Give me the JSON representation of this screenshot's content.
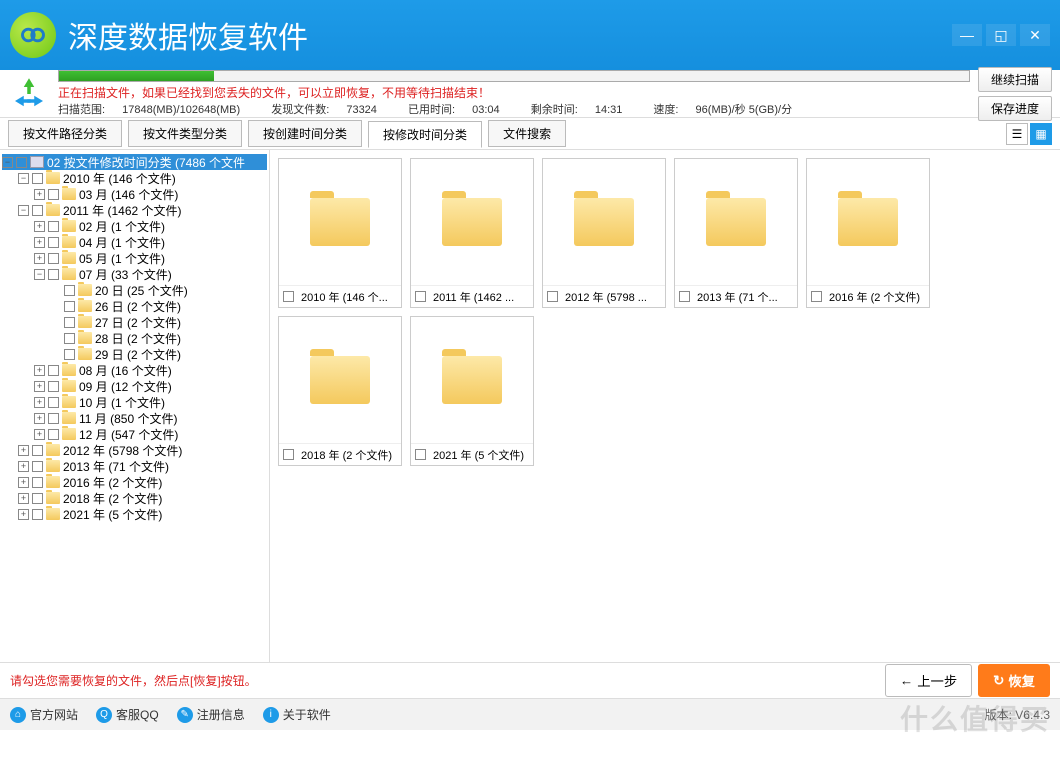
{
  "app": {
    "title": "深度数据恢复软件"
  },
  "scan": {
    "notice": "正在扫描文件，如果已经找到您丢失的文件，可以立即恢复，不用等待扫描结束！",
    "range_label": "扫描范围:",
    "range_value": "17848(MB)/102648(MB)",
    "found_label": "发现文件数:",
    "found_value": "73324",
    "elapsed_label": "已用时间:",
    "elapsed_value": "03:04",
    "remain_label": "剩余时间:",
    "remain_value": "14:31",
    "speed_label": "速度:",
    "speed_value": "96(MB)/秒  5(GB)/分",
    "btn_continue": "继续扫描",
    "btn_save": "保存进度"
  },
  "tabs": {
    "path": "按文件路径分类",
    "type": "按文件类型分类",
    "created": "按创建时间分类",
    "modified": "按修改时间分类",
    "search": "文件搜索"
  },
  "tree": {
    "root": "02 按文件修改时间分类    (7486 个文件",
    "y2010": "2010 年    (146 个文件)",
    "y2010_03": "03 月    (146 个文件)",
    "y2011": "2011 年    (1462 个文件)",
    "y2011_02": "02 月    (1 个文件)",
    "y2011_04": "04 月    (1 个文件)",
    "y2011_05": "05 月    (1 个文件)",
    "y2011_07": "07 月    (33 个文件)",
    "d20": "20 日    (25 个文件)",
    "d26": "26 日    (2 个文件)",
    "d27": "27 日    (2 个文件)",
    "d28": "28 日    (2 个文件)",
    "d29": "29 日    (2 个文件)",
    "y2011_08": "08 月    (16 个文件)",
    "y2011_09": "09 月    (12 个文件)",
    "y2011_10": "10 月    (1 个文件)",
    "y2011_11": "11 月    (850 个文件)",
    "y2011_12": "12 月    (547 个文件)",
    "y2012": "2012 年    (5798 个文件)",
    "y2013": "2013 年    (71 个文件)",
    "y2016": "2016 年    (2 个文件)",
    "y2018": "2018 年    (2 个文件)",
    "y2021": "2021 年    (5 个文件)"
  },
  "thumbs": [
    "2010 年  (146 个...",
    "2011 年  (1462 ...",
    "2012 年  (5798 ...",
    "2013 年  (71 个...",
    "2016 年  (2 个文件)",
    "2018 年  (2 个文件)",
    "2021 年  (5 个文件)"
  ],
  "hint": {
    "text": "请勾选您需要恢复的文件，然后点[恢复]按钮。",
    "prev": "上一步",
    "recover": "恢复"
  },
  "footer": {
    "site": "官方网站",
    "qq": "客服QQ",
    "reg": "注册信息",
    "about": "关于软件",
    "version": "版本: V6.4.3"
  },
  "watermark": "什么值得买"
}
